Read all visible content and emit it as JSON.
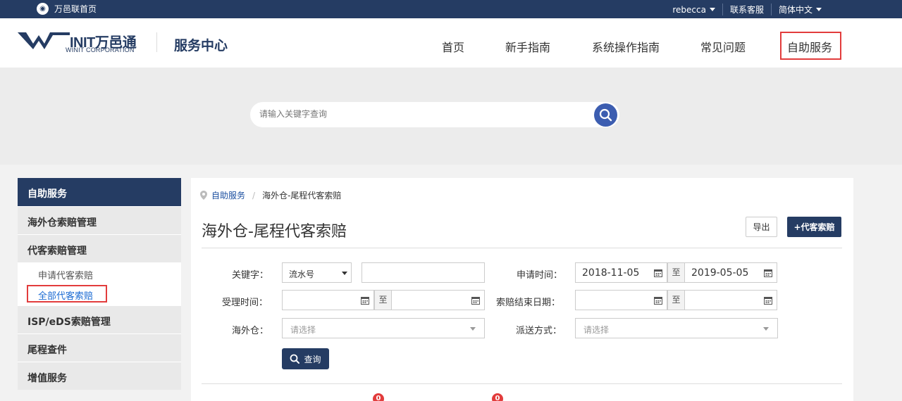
{
  "topbar": {
    "home_label": "万邑联首页",
    "user": "rebecca",
    "contact": "联系客服",
    "language": "简体中文"
  },
  "header": {
    "logo_main": "INIT万邑通",
    "logo_sub": "WINIT CORPORATION",
    "site_title": "服务中心",
    "nav": [
      "首页",
      "新手指南",
      "系统操作指南",
      "常见问题",
      "自助服务"
    ],
    "active_nav": "自助服务"
  },
  "search": {
    "placeholder": "请输入关键字查询"
  },
  "sidebar": {
    "header": "自助服务",
    "items": [
      {
        "label": "海外仓索赔管理"
      },
      {
        "label": "代客索赔管理"
      },
      {
        "label": "ISP/eDS索赔管理"
      },
      {
        "label": "尾程查件"
      },
      {
        "label": "增值服务"
      }
    ],
    "sub_items": [
      {
        "label": "申请代客索赔"
      },
      {
        "label": "全部代客索赔"
      }
    ],
    "active_sub": "全部代客索赔"
  },
  "breadcrumb": {
    "root": "自助服务",
    "current": "海外仓-尾程代客索赔"
  },
  "page": {
    "title": "海外仓-尾程代客索赔",
    "export_label": "导出",
    "add_label": "+代客索赔"
  },
  "filters": {
    "keyword_label": "关键字：",
    "keyword_type": "流水号",
    "keyword_value": "",
    "apply_time_label": "申请时间：",
    "apply_time_start": "2018-11-05",
    "apply_time_end": "2019-05-05",
    "to_label": "至",
    "accept_time_label": "受理时间：",
    "claim_end_label": "索赔结束日期：",
    "warehouse_label": "海外仓：",
    "warehouse_placeholder": "请选择",
    "delivery_label": "派送方式：",
    "delivery_placeholder": "请选择",
    "query_label": "查询"
  },
  "badges": [
    "0",
    "0"
  ],
  "colors": {
    "navy": "#253c63",
    "accent_blue": "#3c5db0",
    "link_blue": "#1b6bd3",
    "highlight_red": "#e23c3c"
  }
}
